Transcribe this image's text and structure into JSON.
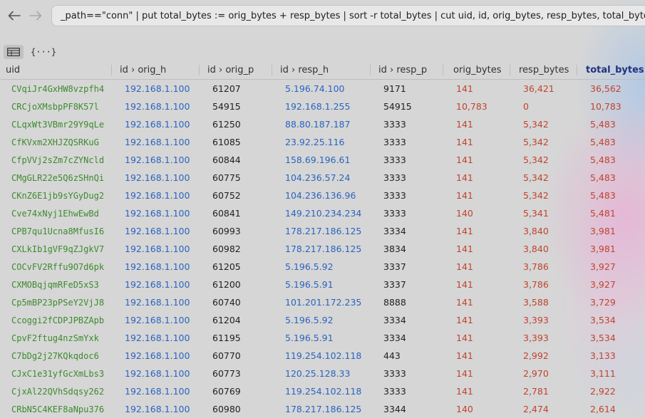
{
  "query": {
    "text": "_path==\"conn\" | put total_bytes := orig_bytes + resp_bytes | sort -r total_bytes | cut uid, id, orig_bytes, resp_bytes, total_bytes"
  },
  "view_toggle": {
    "json_label": "{···}"
  },
  "table": {
    "sorted_column": "total_bytes",
    "headers": {
      "uid": "uid",
      "orig_h": "id › orig_h",
      "orig_p": "id › orig_p",
      "resp_h": "id › resp_h",
      "resp_p": "id › resp_p",
      "orig_bytes": "orig_bytes",
      "resp_bytes": "resp_bytes",
      "total_bytes": "total_bytes"
    },
    "rows": [
      {
        "uid": "CVqiJr4GxHW8vzpfh4",
        "orig_h": "192.168.1.100",
        "orig_p": "61207",
        "resp_h": "5.196.74.100",
        "resp_p": "9171",
        "orig_bytes": "141",
        "resp_bytes": "36,421",
        "total_bytes": "36,562"
      },
      {
        "uid": "CRCjoXMsbpPF8K57l",
        "orig_h": "192.168.1.100",
        "orig_p": "54915",
        "resp_h": "192.168.1.255",
        "resp_p": "54915",
        "orig_bytes": "10,783",
        "resp_bytes": "0",
        "total_bytes": "10,783"
      },
      {
        "uid": "CLqxWt3VBmr29Y9qLe",
        "orig_h": "192.168.1.100",
        "orig_p": "61250",
        "resp_h": "88.80.187.187",
        "resp_p": "3333",
        "orig_bytes": "141",
        "resp_bytes": "5,342",
        "total_bytes": "5,483"
      },
      {
        "uid": "CfKVxm2XHJZQSRKuG",
        "orig_h": "192.168.1.100",
        "orig_p": "61085",
        "resp_h": "23.92.25.116",
        "resp_p": "3333",
        "orig_bytes": "141",
        "resp_bytes": "5,342",
        "total_bytes": "5,483"
      },
      {
        "uid": "CfpVVj2sZm7cZYNcld",
        "orig_h": "192.168.1.100",
        "orig_p": "60844",
        "resp_h": "158.69.196.61",
        "resp_p": "3333",
        "orig_bytes": "141",
        "resp_bytes": "5,342",
        "total_bytes": "5,483"
      },
      {
        "uid": "CMgGLR22e5Q6zSHnQi",
        "orig_h": "192.168.1.100",
        "orig_p": "60775",
        "resp_h": "104.236.57.24",
        "resp_p": "3333",
        "orig_bytes": "141",
        "resp_bytes": "5,342",
        "total_bytes": "5,483"
      },
      {
        "uid": "CKnZ6E1jb9sYGyDug2",
        "orig_h": "192.168.1.100",
        "orig_p": "60752",
        "resp_h": "104.236.136.96",
        "resp_p": "3333",
        "orig_bytes": "141",
        "resp_bytes": "5,342",
        "total_bytes": "5,483"
      },
      {
        "uid": "Cve74xNyj1EhwEwBd",
        "orig_h": "192.168.1.100",
        "orig_p": "60841",
        "resp_h": "149.210.234.234",
        "resp_p": "3333",
        "orig_bytes": "140",
        "resp_bytes": "5,341",
        "total_bytes": "5,481"
      },
      {
        "uid": "CPB7qu1Ucna8MfusI6",
        "orig_h": "192.168.1.100",
        "orig_p": "60993",
        "resp_h": "178.217.186.125",
        "resp_p": "3334",
        "orig_bytes": "141",
        "resp_bytes": "3,840",
        "total_bytes": "3,981"
      },
      {
        "uid": "CXLkIb1gVF9qZJgkV7",
        "orig_h": "192.168.1.100",
        "orig_p": "60982",
        "resp_h": "178.217.186.125",
        "resp_p": "3834",
        "orig_bytes": "141",
        "resp_bytes": "3,840",
        "total_bytes": "3,981"
      },
      {
        "uid": "COCvFV2Rffu9O7d6pk",
        "orig_h": "192.168.1.100",
        "orig_p": "61205",
        "resp_h": "5.196.5.92",
        "resp_p": "3337",
        "orig_bytes": "141",
        "resp_bytes": "3,786",
        "total_bytes": "3,927"
      },
      {
        "uid": "CXMOBqjqmRFeD5xS3",
        "orig_h": "192.168.1.100",
        "orig_p": "61200",
        "resp_h": "5.196.5.91",
        "resp_p": "3337",
        "orig_bytes": "141",
        "resp_bytes": "3,786",
        "total_bytes": "3,927"
      },
      {
        "uid": "Cp5mBP23pPSeY2VjJ8",
        "orig_h": "192.168.1.100",
        "orig_p": "60740",
        "resp_h": "101.201.172.235",
        "resp_p": "8888",
        "orig_bytes": "141",
        "resp_bytes": "3,588",
        "total_bytes": "3,729"
      },
      {
        "uid": "Ccoggi2fCDPJPBZApb",
        "orig_h": "192.168.1.100",
        "orig_p": "61204",
        "resp_h": "5.196.5.92",
        "resp_p": "3334",
        "orig_bytes": "141",
        "resp_bytes": "3,393",
        "total_bytes": "3,534"
      },
      {
        "uid": "CpvF2ftug4nzSmYxk",
        "orig_h": "192.168.1.100",
        "orig_p": "61195",
        "resp_h": "5.196.5.91",
        "resp_p": "3334",
        "orig_bytes": "141",
        "resp_bytes": "3,393",
        "total_bytes": "3,534"
      },
      {
        "uid": "C7bDg2j27KQkqdoc6",
        "orig_h": "192.168.1.100",
        "orig_p": "60770",
        "resp_h": "119.254.102.118",
        "resp_p": "443",
        "orig_bytes": "141",
        "resp_bytes": "2,992",
        "total_bytes": "3,133"
      },
      {
        "uid": "CJxC1e31yfGcXmLbs3",
        "orig_h": "192.168.1.100",
        "orig_p": "60773",
        "resp_h": "120.25.128.33",
        "resp_p": "3333",
        "orig_bytes": "141",
        "resp_bytes": "2,970",
        "total_bytes": "3,111"
      },
      {
        "uid": "CjxAl22QVhSdqsy262",
        "orig_h": "192.168.1.100",
        "orig_p": "60769",
        "resp_h": "119.254.102.118",
        "resp_p": "3333",
        "orig_bytes": "141",
        "resp_bytes": "2,781",
        "total_bytes": "2,922"
      },
      {
        "uid": "CRbN5C4KEF8aNpu376",
        "orig_h": "192.168.1.100",
        "orig_p": "60980",
        "resp_h": "178.217.186.125",
        "resp_p": "3344",
        "orig_bytes": "140",
        "resp_bytes": "2,474",
        "total_bytes": "2,614"
      }
    ]
  },
  "colors": {
    "uid": "#3d8a2e",
    "ip": "#2a64c0",
    "bytes": "#c0432e",
    "sorted_header": "#23307e"
  },
  "icons": {
    "back": "arrow-left-icon",
    "forward": "arrow-right-icon",
    "table_view": "table-icon"
  }
}
